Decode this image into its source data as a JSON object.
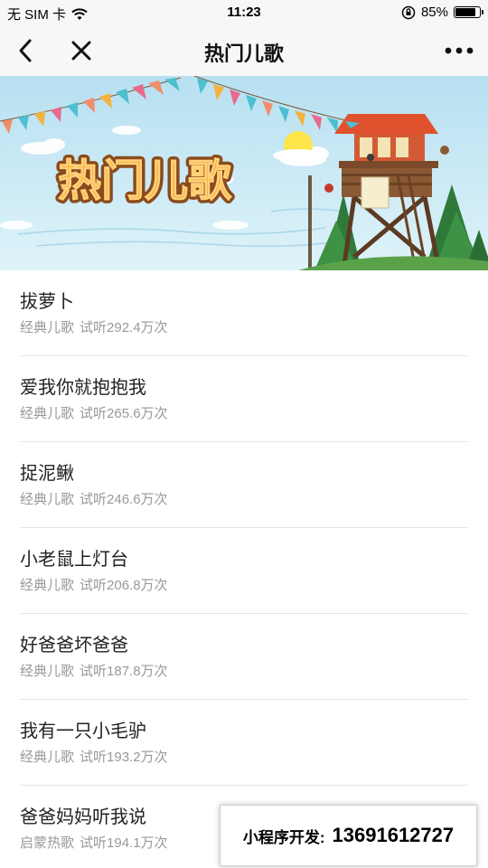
{
  "status_bar": {
    "carrier": "无 SIM 卡",
    "time": "11:23",
    "battery": "85%",
    "battery_level": 0.85
  },
  "nav": {
    "title": "热门儿歌"
  },
  "banner": {
    "title": "热门儿歌"
  },
  "songs": [
    {
      "title": "拔萝卜",
      "category": "经典儿歌",
      "plays": "试听292.4万次"
    },
    {
      "title": "爱我你就抱抱我",
      "category": "经典儿歌",
      "plays": "试听265.6万次"
    },
    {
      "title": "捉泥鳅",
      "category": "经典儿歌",
      "plays": "试听246.6万次"
    },
    {
      "title": "小老鼠上灯台",
      "category": "经典儿歌",
      "plays": "试听206.8万次"
    },
    {
      "title": "好爸爸坏爸爸",
      "category": "经典儿歌",
      "plays": "试听187.8万次"
    },
    {
      "title": "我有一只小毛驴",
      "category": "经典儿歌",
      "plays": "试听193.2万次"
    },
    {
      "title": "爸爸妈妈听我说",
      "category": "启蒙热歌",
      "plays": "试听194.1万次"
    }
  ],
  "promo": {
    "label": "小程序开发:",
    "phone": "13691612727"
  }
}
